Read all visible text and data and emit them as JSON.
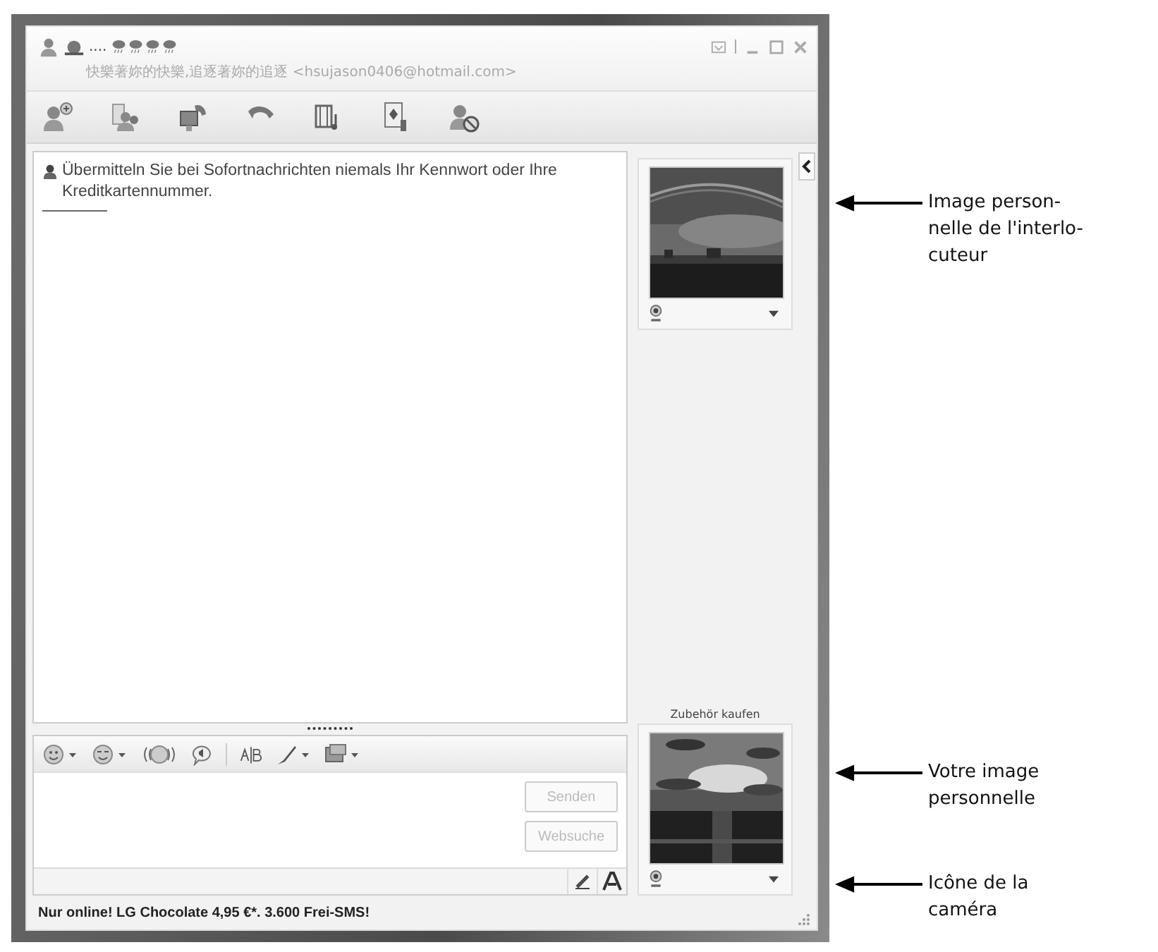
{
  "window": {
    "display_name": "....",
    "personal_message": "快樂著妳的快樂,追逐著妳的追逐 <hsujason0406@hotmail.com>"
  },
  "conversation": {
    "warning": "Übermitteln Sie bei Sofortnachrichten niemals Ihr Kennwort oder Ihre Kreditkartennummer."
  },
  "input_buttons": [
    {
      "label": "Senden",
      "disabled": true
    },
    {
      "label": "Websuche",
      "disabled": true
    }
  ],
  "sidebar": {
    "shop_link": "Zubehör kaufen"
  },
  "status_bar": {
    "text": "Nur online! LG Chocolate 4,95 €*. 3.600 Frei-SMS!"
  },
  "annotations": [
    {
      "text": "Image person-\nnelle de l'interlo-\ncuteur"
    },
    {
      "text": "Votre image\npersonnelle"
    },
    {
      "text": "Icône de la\ncaméra"
    }
  ]
}
